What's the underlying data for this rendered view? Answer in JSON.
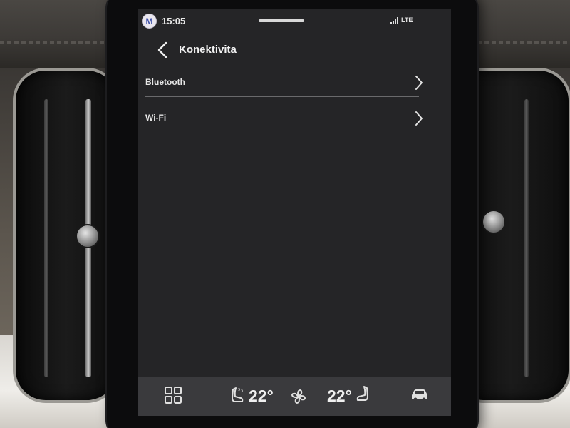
{
  "status_bar": {
    "avatar_initial": "M",
    "time": "15:05",
    "network": "LTE"
  },
  "header": {
    "back_icon": "chevron-left-icon",
    "title": "Konektivita"
  },
  "settings_list": [
    {
      "label": "Bluetooth",
      "icon": "chevron-right-icon"
    },
    {
      "label": "Wi-Fi",
      "icon": "chevron-right-icon"
    }
  ],
  "climate_bar": {
    "apps_icon": "app-grid-icon",
    "left_seat_icon": "seat-heat-icon",
    "left_temp": "22°",
    "fan_icon": "fan-icon",
    "right_temp": "22°",
    "right_seat_icon": "seat-icon",
    "car_icon": "car-icon"
  },
  "colors": {
    "screen_bg": "#252527",
    "bottom_bar_bg": "#3a3a3d",
    "text": "#e6e6e6",
    "divider": "#6a6a6c"
  }
}
